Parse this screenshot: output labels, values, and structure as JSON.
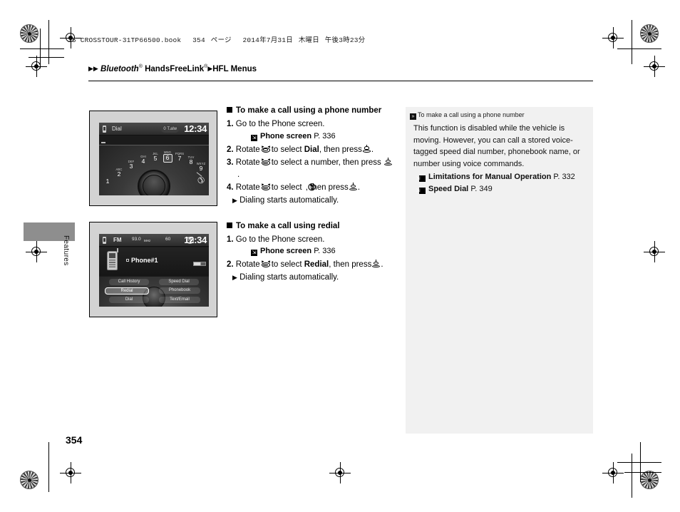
{
  "print": {
    "book_line_parts": [
      "15 CROSSTOUR-31TP66500.book",
      "354",
      "ページ",
      "2014年7月31日",
      "木曜日",
      "午後3時23分"
    ]
  },
  "breadcrumb": {
    "item1": "Bluetooth",
    "item1_sup": "®",
    "item2": "HandsFreeLink",
    "item2_sup": "®",
    "item3": "HFL Menus"
  },
  "side_tab": {
    "label": "Features"
  },
  "page_number": "354",
  "figures": {
    "dial": {
      "status": {
        "title": "Dial",
        "pill": "0 T.alw",
        "clock": "12:34"
      },
      "keys": [
        {
          "letters": "",
          "digit": "1"
        },
        {
          "letters": "ABC",
          "digit": "2"
        },
        {
          "letters": "DEF",
          "digit": "3"
        },
        {
          "letters": "GHI",
          "digit": "4"
        },
        {
          "letters": "JKL",
          "digit": "5"
        },
        {
          "letters": "MNO",
          "digit": "6"
        },
        {
          "letters": "PQRS",
          "digit": "7"
        },
        {
          "letters": "TUV",
          "digit": "8"
        },
        {
          "letters": "WXYZ",
          "digit": "9"
        }
      ],
      "selected_digit": "6"
    },
    "menu": {
      "status": {
        "band": "FM",
        "frequency": "93.0",
        "freq_unit": "MHz",
        "speed": "60",
        "gear": "N",
        "clock": "12:34"
      },
      "phone_label": "Phone#1",
      "buttons": [
        {
          "label": "Call History",
          "selected": false
        },
        {
          "label": "Speed Dial",
          "selected": false
        },
        {
          "label": "Redial",
          "selected": true
        },
        {
          "label": "Phonebook",
          "selected": false
        },
        {
          "label": "Dial",
          "selected": false
        },
        {
          "label": "Text/Email",
          "selected": false
        }
      ]
    }
  },
  "sections": [
    {
      "heading": "To make a call using a phone number",
      "steps": [
        {
          "num": "1.",
          "text_before": "Go to the Phone screen.",
          "type": "plain"
        },
        {
          "type": "xref",
          "title": "Phone screen",
          "page": "P. 336"
        },
        {
          "num": "2.",
          "type": "rotate",
          "pre": "Rotate",
          "mid": "to select",
          "target": "Dial",
          "post": ", then press",
          "end": "."
        },
        {
          "num": "3.",
          "type": "rotate_wrap",
          "pre": "Rotate",
          "mid": "to select a number, then press",
          "end": "."
        },
        {
          "num": "4.",
          "type": "rotate_call",
          "pre": "Rotate",
          "mid": "to select",
          "post": ", then press",
          "end": "."
        },
        {
          "type": "sub",
          "text": "Dialing starts automatically."
        }
      ]
    },
    {
      "heading": "To make a call using redial",
      "steps": [
        {
          "num": "1.",
          "text_before": "Go to the Phone screen.",
          "type": "plain"
        },
        {
          "type": "xref",
          "title": "Phone screen",
          "page": "P. 336"
        },
        {
          "num": "2.",
          "type": "rotate",
          "pre": "Rotate",
          "mid": "to select",
          "target": "Redial",
          "post": ", then press",
          "end": "."
        },
        {
          "type": "sub",
          "text": "Dialing starts automatically."
        }
      ]
    }
  ],
  "note": {
    "header": "To make a call using a phone number",
    "body": "This function is disabled while the vehicle is moving. However, you can call a stored voice-tagged speed dial number, phonebook name, or number using voice commands.",
    "xrefs": [
      {
        "title": "Limitations for Manual Operation",
        "page": "P. 332"
      },
      {
        "title": "Speed Dial",
        "page": "P. 349"
      }
    ]
  },
  "colors": {
    "note_bg": "#f1f1f1",
    "tab_block": "#8e8e8e",
    "figure_bg": "#d3d3d3"
  }
}
